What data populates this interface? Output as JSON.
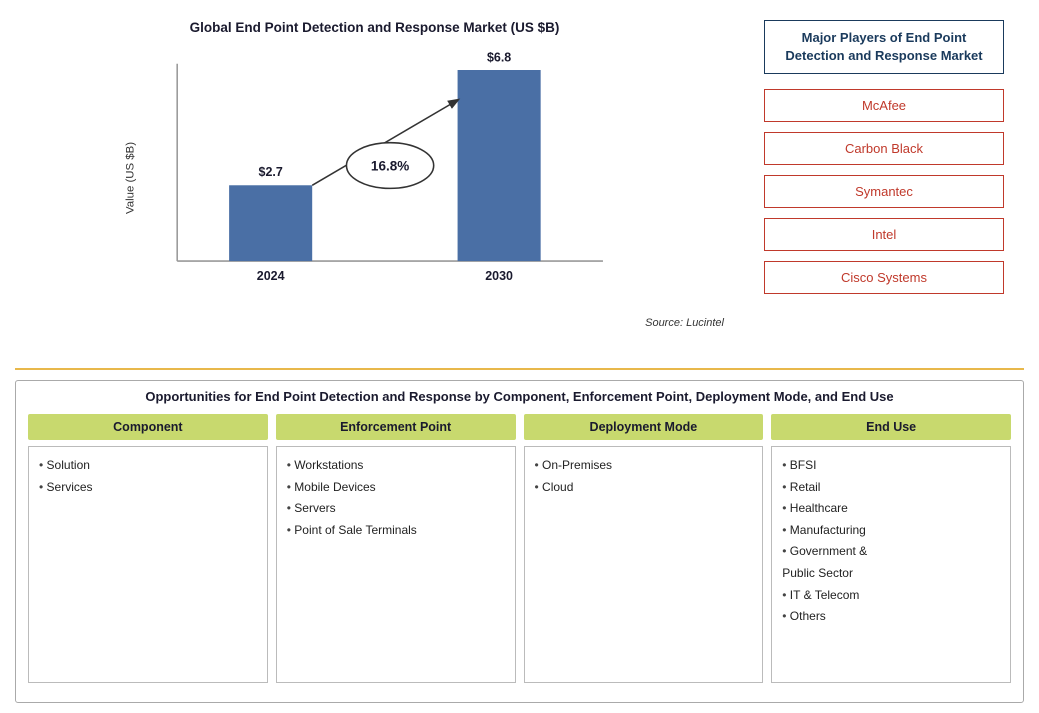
{
  "chart": {
    "title": "Global End Point Detection and Response Market (US $B)",
    "source": "Source: Lucintel",
    "bars": [
      {
        "year": "2024",
        "value": 2.7,
        "label": "$2.7"
      },
      {
        "year": "2030",
        "value": 6.8,
        "label": "$6.8"
      }
    ],
    "cagr": "16.8%",
    "y_axis_label": "Value (US $B)"
  },
  "players": {
    "title": "Major Players of End Point Detection and Response Market",
    "items": [
      {
        "name": "McAfee"
      },
      {
        "name": "Carbon Black"
      },
      {
        "name": "Symantec"
      },
      {
        "name": "Intel"
      },
      {
        "name": "Cisco Systems"
      }
    ]
  },
  "opportunities": {
    "title": "Opportunities for End Point Detection and Response by Component, Enforcement Point, Deployment Mode, and End Use",
    "columns": [
      {
        "header": "Component",
        "items": [
          "Solution",
          "Services"
        ]
      },
      {
        "header": "Enforcement Point",
        "items": [
          "Workstations",
          "Mobile Devices",
          "Servers",
          "Point of Sale Terminals"
        ]
      },
      {
        "header": "Deployment Mode",
        "items": [
          "On-Premises",
          "Cloud"
        ]
      },
      {
        "header": "End Use",
        "items": [
          "BFSI",
          "Retail",
          "Healthcare",
          "Manufacturing",
          "Government &\nPublic Sector",
          "IT & Telecom",
          "Others"
        ]
      }
    ]
  }
}
